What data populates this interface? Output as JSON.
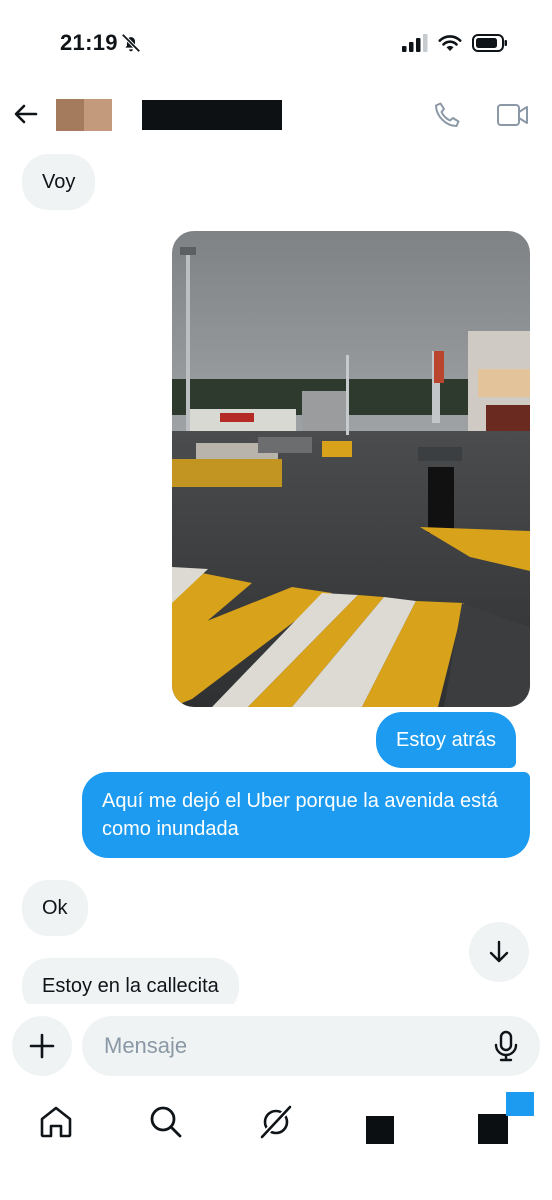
{
  "status_bar": {
    "time": "21:19"
  },
  "header": {
    "contact_name": ""
  },
  "messages": [
    {
      "direction": "incoming",
      "text": "Voy"
    },
    {
      "direction": "outgoing",
      "type": "photo"
    },
    {
      "direction": "outgoing",
      "text": "Estoy atrás"
    },
    {
      "direction": "outgoing",
      "text": "Aquí me dejó el Uber porque la avenida está como inundada"
    },
    {
      "direction": "incoming",
      "text": "Ok"
    },
    {
      "direction": "incoming",
      "text": "Estoy en la callecita"
    }
  ],
  "composer": {
    "placeholder": "Mensaje"
  },
  "colors": {
    "accent": "#1d9bf0",
    "bubble_in": "#eff3f4",
    "text": "#0f1419"
  },
  "icons": [
    "bell-off-icon",
    "signal-icon",
    "wifi-icon",
    "battery-icon",
    "back-arrow-icon",
    "phone-icon",
    "video-icon",
    "arrow-down-icon",
    "plus-icon",
    "microphone-icon",
    "home-icon",
    "search-icon",
    "grok-icon"
  ]
}
